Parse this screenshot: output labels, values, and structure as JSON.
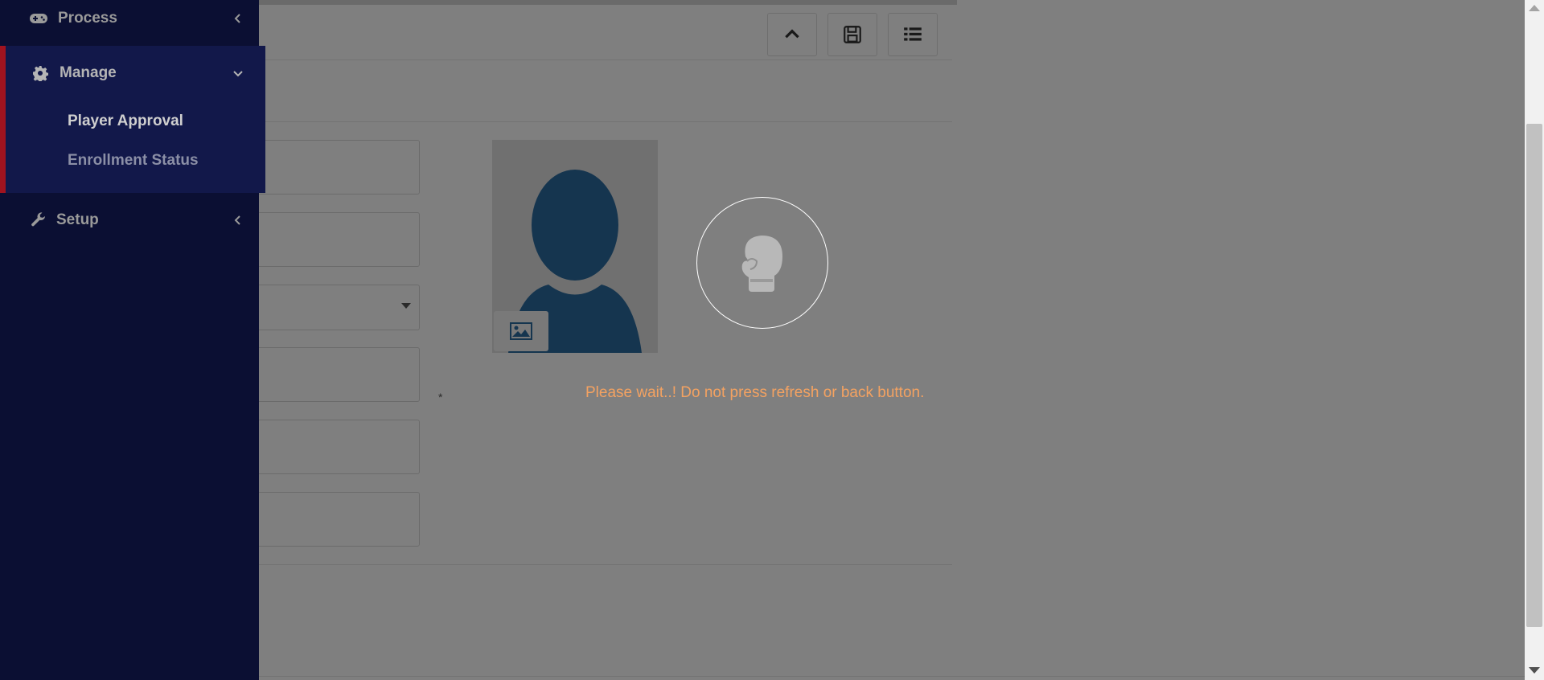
{
  "sidebar": {
    "items": [
      {
        "label": "Process",
        "icon": "gamepad-icon",
        "state": "collapsed"
      },
      {
        "label": "Manage",
        "icon": "gear-icon",
        "state": "expanded",
        "children": [
          {
            "label": "Player Approval",
            "active": true
          },
          {
            "label": "Enrollment Status",
            "active": false
          }
        ]
      },
      {
        "label": "Setup",
        "icon": "wrench-icon",
        "state": "collapsed"
      }
    ]
  },
  "toolbar": {
    "buttons": [
      "chevron-up-icon",
      "save-icon",
      "list-icon"
    ]
  },
  "form": {
    "required_marker": "*"
  },
  "loading": {
    "message": "Please wait..! Do not press refresh or back button.",
    "icon": "boxing-glove-icon"
  },
  "colors": {
    "sidebar_bg": "#0b0f33",
    "active_group_bg": "#12184a",
    "active_marker": "#a0131f",
    "wait_text": "#f4a261",
    "avatar_blue": "#2b6a9e"
  }
}
